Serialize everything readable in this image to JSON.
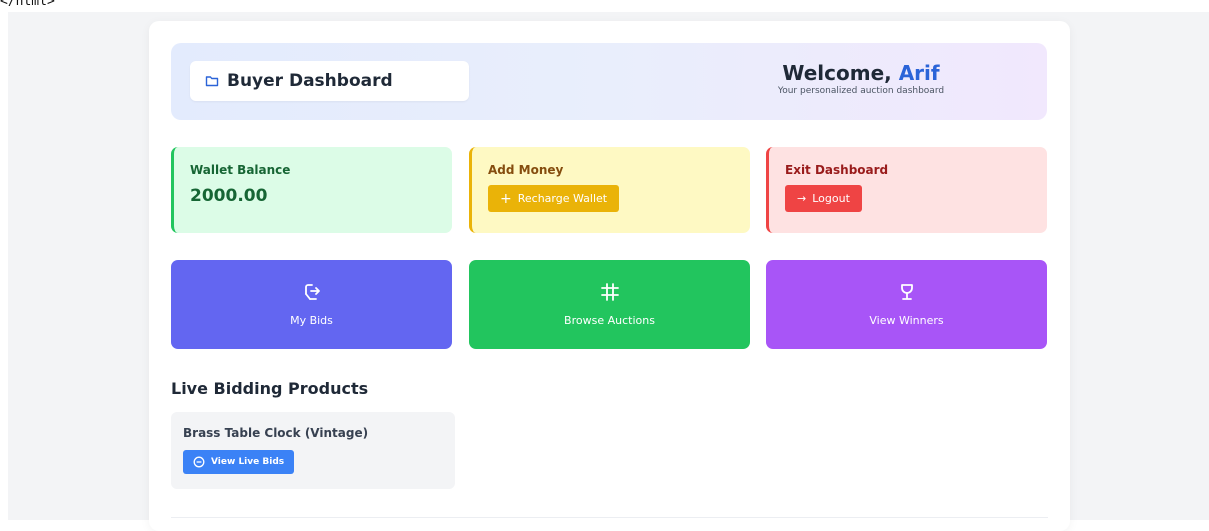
{
  "top_fragment": "</html>",
  "header": {
    "title": "Buyer Dashboard",
    "welcome_prefix": "Welcome, ",
    "user_name": "Arif",
    "subtitle": "Your personalized auction dashboard"
  },
  "wallet": {
    "label": "Wallet Balance",
    "amount": "2000.00"
  },
  "add_money": {
    "label": "Add Money",
    "button": "Recharge Wallet"
  },
  "exit": {
    "label": "Exit Dashboard",
    "button": "Logout"
  },
  "tiles": {
    "my_bids": "My Bids",
    "browse": "Browse Auctions",
    "winners": "View Winners"
  },
  "live": {
    "title": "Live Bidding Products",
    "products": [
      {
        "name": "Brass Table Clock (Vintage)",
        "button": "View Live Bids"
      }
    ]
  },
  "icons": {
    "title": "folder-icon",
    "recharge": "plus-icon",
    "logout": "arrow-right-icon",
    "my_bids": "hand-arrow-icon",
    "browse": "grid-icon",
    "winners": "trophy-icon",
    "view_bids": "circle-minus-icon"
  },
  "colors": {
    "accent_blue": "#2b64d8",
    "wallet_green": "#22c55e",
    "money_yellow": "#eab308",
    "exit_red": "#ef4444",
    "tile_indigo": "#6366f1",
    "tile_green": "#22c55e",
    "tile_purple": "#a855f7",
    "button_blue": "#3b82f6"
  }
}
